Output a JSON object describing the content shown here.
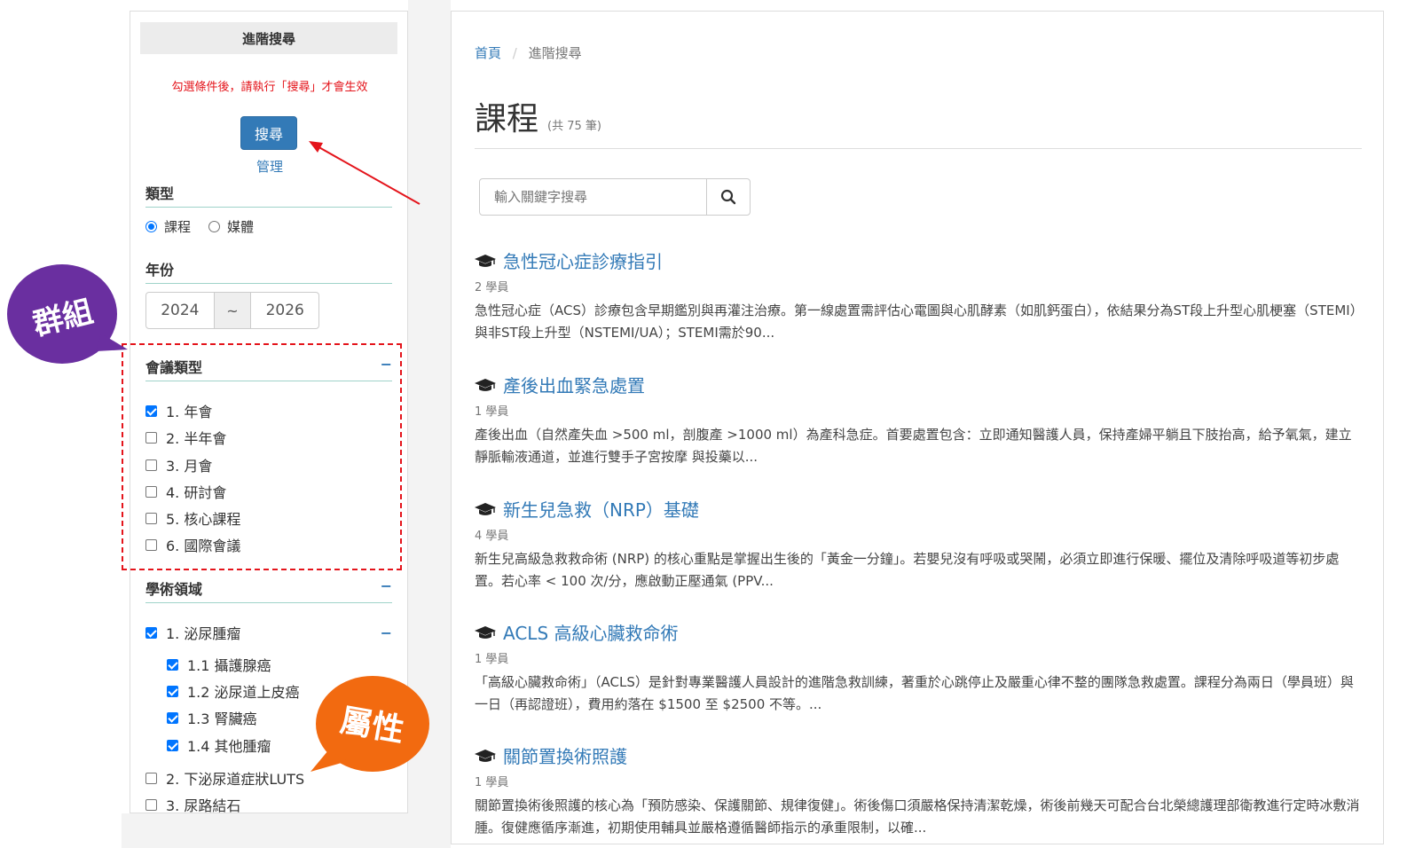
{
  "sidebar": {
    "header": "進階搜尋",
    "hint": "勾選條件後，請執行「搜尋」才會生效",
    "search_button": "搜尋",
    "manage_link": "管理",
    "type_section": {
      "title": "類型",
      "options": [
        {
          "label": "課程",
          "selected": true
        },
        {
          "label": "媒體",
          "selected": false
        }
      ]
    },
    "year_section": {
      "title": "年份",
      "from": "2024",
      "separator": "~",
      "to": "2026"
    },
    "meeting_section": {
      "title": "會議類型",
      "toggle": "−",
      "items": [
        {
          "label": "1. 年會",
          "checked": true
        },
        {
          "label": "2. 半年會",
          "checked": false
        },
        {
          "label": "3. 月會",
          "checked": false
        },
        {
          "label": "4. 研討會",
          "checked": false
        },
        {
          "label": "5. 核心課程",
          "checked": false
        },
        {
          "label": "6. 國際會議",
          "checked": false
        }
      ]
    },
    "field_section": {
      "title": "學術領域",
      "toggle": "−",
      "parent": {
        "label": "1. 泌尿腫瘤",
        "checked": true,
        "toggle": "−"
      },
      "children": [
        {
          "label": "1.1 攝護腺癌",
          "checked": true
        },
        {
          "label": "1.2 泌尿道上皮癌",
          "checked": true
        },
        {
          "label": "1.3 腎臟癌",
          "checked": true
        },
        {
          "label": "1.4 其他腫瘤",
          "checked": true
        }
      ],
      "more": [
        {
          "label": "2. 下泌尿道症狀LUTS",
          "checked": false
        },
        {
          "label": "3. 尿路結石",
          "checked": false
        }
      ]
    }
  },
  "callouts": {
    "group": "群組",
    "attribute": "屬性"
  },
  "colors": {
    "group_callout": "#6a2fa0",
    "attribute_callout": "#f26a10",
    "link": "#337ab7",
    "alert": "#e4141b"
  },
  "main": {
    "breadcrumb": {
      "home": "首頁",
      "sep": "/",
      "current": "進階搜尋"
    },
    "title": "課程",
    "count": "(共 75 筆)",
    "search_placeholder": "輸入關鍵字搜尋",
    "courses": [
      {
        "title": "急性冠心症診療指引",
        "students": "2 學員",
        "desc": "急性冠心症（ACS）診療包含早期鑑別與再灌注治療。第一線處置需評估心電圖與心肌酵素（如肌鈣蛋白），依結果分為ST段上升型心肌梗塞（STEMI）與非ST段上升型（NSTEMI/UA）；STEMI需於90..."
      },
      {
        "title": "產後出血緊急處置",
        "students": "1 學員",
        "desc": "產後出血（自然產失血 >500 ml，剖腹產 >1000 ml）為產科急症。首要處置包含：立即通知醫護人員，保持產婦平躺且下肢抬高，給予氧氣，建立靜脈輸液通道，並進行雙手子宮按摩 與投藥以..."
      },
      {
        "title": "新生兒急救（NRP）基礎",
        "students": "4 學員",
        "desc": "新生兒高級急救救命術 (NRP) 的核心重點是掌握出生後的「黃金一分鐘」。若嬰兒沒有呼吸或哭鬧，必須立即進行保暖、擺位及清除呼吸道等初步處置。若心率 < 100 次/分，應啟動正壓通氣 (PPV..."
      },
      {
        "title": "ACLS 高級心臟救命術",
        "students": "1 學員",
        "desc": "「高級心臟救命術」（ACLS）是針對專業醫護人員設計的進階急救訓練，著重於心跳停止及嚴重心律不整的團隊急救處置。課程分為兩日（學員班）與一日（再認證班），費用約落在 $1500 至 $2500 不等。..."
      },
      {
        "title": "關節置換術照護",
        "students": "1 學員",
        "desc": "關節置換術後照護的核心為「預防感染、保護關節、規律復健」。術後傷口須嚴格保持清潔乾燥，術後前幾天可配合台北榮總護理部衛教進行定時冰敷消腫。復健應循序漸進，初期使用輔具並嚴格遵循醫師指示的承重限制，以確..."
      }
    ]
  }
}
